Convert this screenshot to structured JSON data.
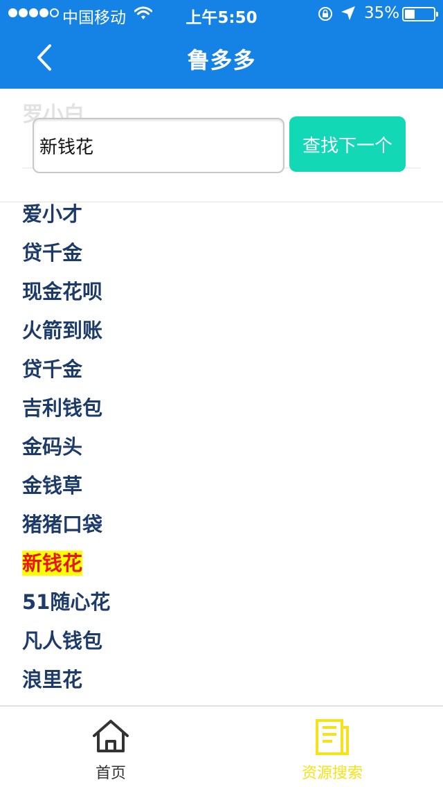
{
  "status_bar": {
    "carrier": "中国移动",
    "time": "上午5:50",
    "battery_percent": "35%",
    "battery_level": 0.35,
    "signal_bars": 4
  },
  "nav": {
    "title": "鲁多多",
    "back_icon": "chevron-left-icon"
  },
  "search": {
    "ghost_text": "罗小白",
    "value": "新钱花",
    "button_label": "查找下一个"
  },
  "list": {
    "items": [
      "爱小才",
      "贷千金",
      "现金花呗",
      "火箭到账",
      "贷千金",
      "吉利钱包",
      "金码头",
      "金钱草",
      "猪猪口袋",
      "新钱花",
      "51随心花",
      "凡人钱包",
      "浪里花"
    ],
    "highlight_index": 9
  },
  "tabbar": {
    "tabs": [
      {
        "label": "首页",
        "icon": "home-icon",
        "color": "#333333"
      },
      {
        "label": "资源搜索",
        "icon": "document-icon",
        "color": "#f5e218"
      }
    ],
    "active_index": 1
  },
  "colors": {
    "nav_bg": "#1583e6",
    "find_button": "#12d8b6",
    "list_text": "#1c3a6a",
    "highlight_bg": "#ffff00",
    "highlight_text": "#e8151b"
  }
}
